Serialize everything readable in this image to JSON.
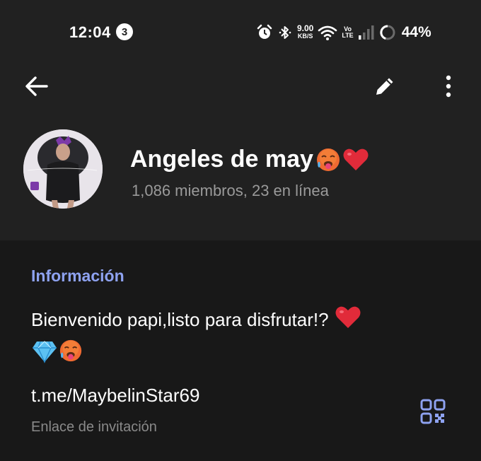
{
  "status_bar": {
    "time": "12:04",
    "notification_count": "3",
    "net_speed_value": "9.00",
    "net_speed_unit": "KB/S",
    "volte_top": "Vo",
    "volte_bottom": "LTE",
    "battery_percent": "44%",
    "icons": [
      "alarm-icon",
      "bluetooth-icon",
      "wifi-icon",
      "signal-icon",
      "battery-icon"
    ]
  },
  "toolbar": {
    "icons": [
      "back-arrow-icon",
      "pencil-icon",
      "more-vertical-icon"
    ]
  },
  "profile": {
    "name": "Angeles de may",
    "name_emojis": [
      "hot-face-emoji",
      "red-heart-emoji"
    ],
    "members": "1,086 miembros, 23 en línea"
  },
  "info": {
    "heading": "Información",
    "description": "Bienvenido papi,listo para disfrutar!?",
    "description_emojis": [
      "red-heart-emoji",
      "gem-emoji",
      "hot-face-emoji"
    ],
    "invite_link": "t.me/MaybelinStar69",
    "invite_caption": "Enlace de invitación"
  },
  "colors": {
    "background": "#212121",
    "info_background": "#181818",
    "accent": "#8ea2f0",
    "secondary_text": "#9a9a9a"
  }
}
